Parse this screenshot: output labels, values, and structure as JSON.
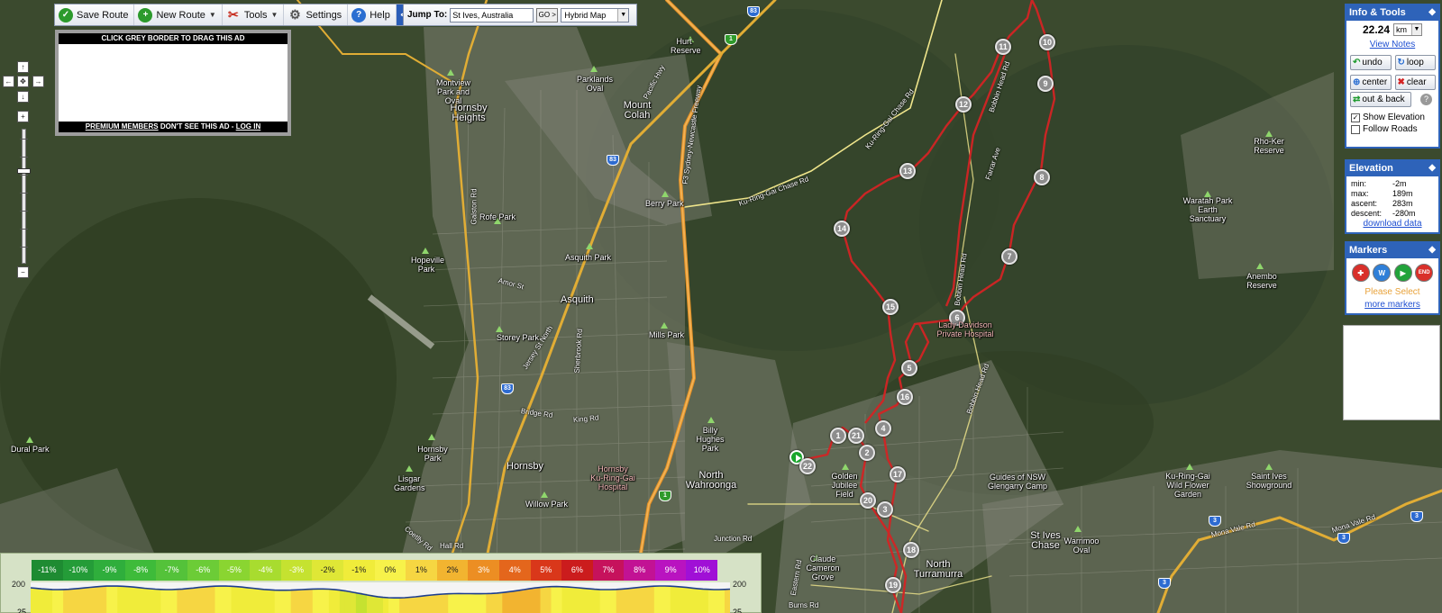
{
  "toolbar": {
    "buttons": [
      {
        "label": "Save Route",
        "icon": "check-icon"
      },
      {
        "label": "New Route",
        "icon": "plus-icon"
      },
      {
        "label": "Tools",
        "icon": "tools-icon"
      },
      {
        "label": "Settings",
        "icon": "gear-icon"
      },
      {
        "label": "Help",
        "icon": "help-icon"
      }
    ],
    "collapse_label": "<<"
  },
  "jump": {
    "label": "Jump To:",
    "value": "St Ives, Australia",
    "go_label": "GO >",
    "map_type": "Hybrid Map"
  },
  "ad": {
    "top": "CLICK GREY BORDER TO DRAG THIS AD",
    "bottom_premium": "PREMIUM MEMBERS",
    "bottom_mid": " DON'T SEE THIS AD - ",
    "bottom_login": "LOG IN"
  },
  "info_tools": {
    "title": "Info & Tools",
    "distance": "22.24",
    "unit": "km",
    "view_notes": "View Notes",
    "tools": [
      "undo",
      "loop",
      "center",
      "clear"
    ],
    "out_back": "out & back",
    "help": "?",
    "show_elevation": "Show Elevation",
    "show_elevation_checked": true,
    "follow_roads": "Follow Roads",
    "follow_roads_checked": false
  },
  "elevation": {
    "title": "Elevation",
    "rows": [
      {
        "k": "min:",
        "v": "-2m"
      },
      {
        "k": "max:",
        "v": "189m"
      },
      {
        "k": "ascent:",
        "v": "283m"
      },
      {
        "k": "descent:",
        "v": "-280m"
      }
    ],
    "download": "download data"
  },
  "markers_panel": {
    "title": "Markers",
    "items": [
      {
        "name": "first-aid-marker-icon",
        "color": "#d9302a",
        "glyph": "✚"
      },
      {
        "name": "water-marker-icon",
        "color": "#2f7fd8",
        "glyph": "W"
      },
      {
        "name": "start-marker-icon",
        "color": "#21a33a",
        "glyph": "▶"
      },
      {
        "name": "end-marker-icon",
        "color": "#d9302a",
        "glyph": "END"
      }
    ],
    "please": "Please Select",
    "more": "more markers"
  },
  "grade_legend": {
    "steps": [
      {
        "label": "-11%",
        "color": "#1e8b32"
      },
      {
        "label": "-10%",
        "color": "#249c38"
      },
      {
        "label": "-9%",
        "color": "#2fae3c"
      },
      {
        "label": "-8%",
        "color": "#3ebb3a"
      },
      {
        "label": "-7%",
        "color": "#54c23a"
      },
      {
        "label": "-6%",
        "color": "#6ccc37"
      },
      {
        "label": "-5%",
        "color": "#8ad531"
      },
      {
        "label": "-4%",
        "color": "#a8dc2f"
      },
      {
        "label": "-3%",
        "color": "#c5e230"
      },
      {
        "label": "-2%",
        "color": "#dfe736"
      },
      {
        "label": "-1%",
        "color": "#f0ec3a"
      },
      {
        "label": "0%",
        "color": "#f7f24a"
      },
      {
        "label": "1%",
        "color": "#f6d642"
      },
      {
        "label": "2%",
        "color": "#f2b430"
      },
      {
        "label": "3%",
        "color": "#ec8e23"
      },
      {
        "label": "4%",
        "color": "#e4661c"
      },
      {
        "label": "5%",
        "color": "#d9371a"
      },
      {
        "label": "6%",
        "color": "#cb1c1d"
      },
      {
        "label": "7%",
        "color": "#c6125c"
      },
      {
        "label": "8%",
        "color": "#c21294"
      },
      {
        "label": "9%",
        "color": "#b913c0"
      },
      {
        "label": "10%",
        "color": "#a010d6"
      }
    ],
    "axis_top": "200",
    "axis_bottom": "25"
  },
  "map": {
    "route_markers": [
      "1",
      "2",
      "3",
      "4",
      "5",
      "6",
      "7",
      "8",
      "9",
      "10",
      "11",
      "12",
      "13",
      "14",
      "15",
      "16",
      "17",
      "18",
      "19",
      "20",
      "21",
      "22"
    ],
    "suburbs": [
      "Hornsby Heights",
      "Mount Colah",
      "Asquith",
      "Hornsby",
      "North Wahroonga",
      "North Turramurra",
      "St Ives Chase"
    ],
    "parks": [
      "Montview Park and Oval",
      "Parklands Oval",
      "Hurt Reserve",
      "Berry Park",
      "Rofe Park",
      "Hopeville Park",
      "Asquith Park",
      "Storey Park",
      "Mills Park",
      "Billy Hughes Park",
      "Dural Park",
      "Hornsby Park",
      "Lisgar Gardens",
      "Willow Park",
      "Golden Jubilee Field",
      "Claude Cameron Grove",
      "Guides of NSW Glengarry Camp",
      "Warrimoo Oval",
      "Ku-Ring-Gai Wild Flower Garden",
      "Saint Ives Showground",
      "Rho-Ker Reserve",
      "Waratah Park Earth Sanctuary",
      "Anembo Reserve",
      "Rofe Park"
    ],
    "hospitals": [
      "Lady Davidson Private Hospital",
      "Hornsby Ku-Ring-Gai Hospital"
    ],
    "roads": [
      "Pacific Hwy",
      "F3 Sydney-Newcastle Freeway",
      "Ku-Ring-Gai Chase Rd",
      "Bobbin Head Rd",
      "Galston Rd",
      "Amor St",
      "Bridge Rd",
      "King Rd",
      "Junction Rd",
      "Mona Vale Rd",
      "Eastern Rd",
      "Burns Rd",
      "Hall Rd",
      "Jersey St North",
      "Sherbrook Rd",
      "Coetlly Rd",
      "Farrar Ave"
    ]
  }
}
